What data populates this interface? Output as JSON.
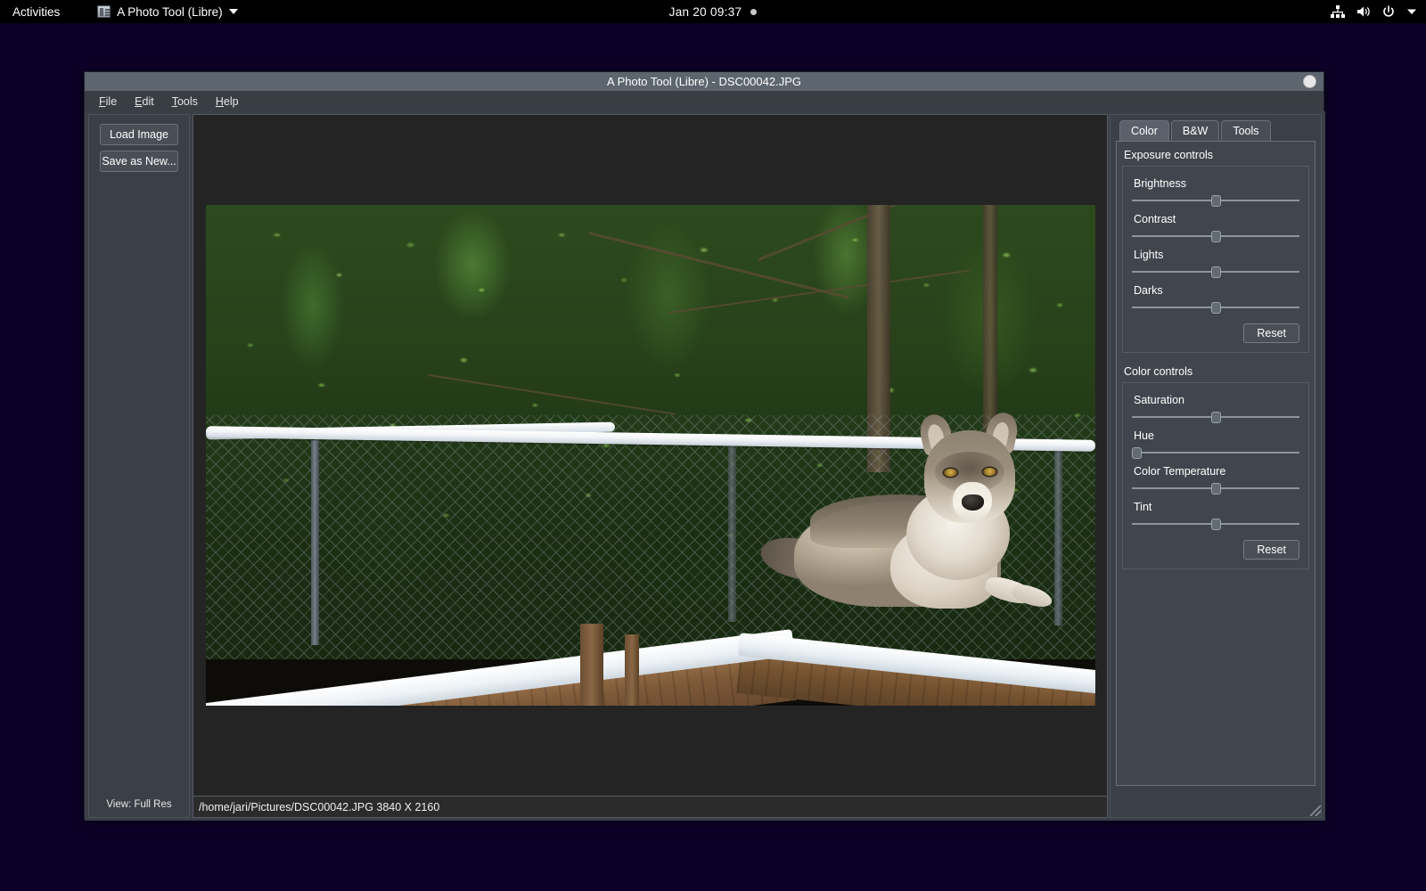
{
  "desktop": {
    "activities_label": "Activities",
    "app_menu_label": "A Photo Tool (Libre)",
    "clock": "Jan 20  09:37",
    "tray_icons": [
      "network-icon",
      "volume-icon",
      "power-icon",
      "chevron-down-icon"
    ]
  },
  "window": {
    "title": "A Photo Tool (Libre) - DSC00042.JPG",
    "close_button": "close-button"
  },
  "menubar": [
    {
      "label": "File",
      "mnemonic": "F"
    },
    {
      "label": "Edit",
      "mnemonic": "E"
    },
    {
      "label": "Tools",
      "mnemonic": "T"
    },
    {
      "label": "Help",
      "mnemonic": "H"
    }
  ],
  "left_panel": {
    "buttons": [
      {
        "label": "Load Image"
      },
      {
        "label": "Save as New..."
      }
    ],
    "view_label": "View: Full Res"
  },
  "statusbar": {
    "path_and_size": "/home/jari/Pictures/DSC00042.JPG 3840 X 2160"
  },
  "right_panel": {
    "tabs": [
      {
        "label": "Color",
        "active": true
      },
      {
        "label": "B&W",
        "active": false
      },
      {
        "label": "Tools",
        "active": false
      }
    ],
    "exposure": {
      "title": "Exposure controls",
      "sliders": [
        {
          "label": "Brightness",
          "value": 50
        },
        {
          "label": "Contrast",
          "value": 50
        },
        {
          "label": "Lights",
          "value": 50
        },
        {
          "label": "Darks",
          "value": 50
        }
      ],
      "reset_label": "Reset"
    },
    "color": {
      "title": "Color controls",
      "sliders": [
        {
          "label": "Saturation",
          "value": 50
        },
        {
          "label": "Hue",
          "value": 0
        },
        {
          "label": "Color Temperature",
          "value": 50
        },
        {
          "label": "Tint",
          "value": 50
        }
      ],
      "reset_label": "Reset"
    }
  },
  "photo": {
    "subject": "grey wolf resting on snow covered wooden shelter roof",
    "scene": "green foliage and chain link fence with snow in winter"
  },
  "colors": {
    "topbar_bg": "#000000",
    "desktop_bg": "#0d0028",
    "window_bg": "#3b4048",
    "titlebar_bg": "#5d656e",
    "panel_bg": "#41464e",
    "canvas_bg": "#242424",
    "text": "#ffffff"
  }
}
